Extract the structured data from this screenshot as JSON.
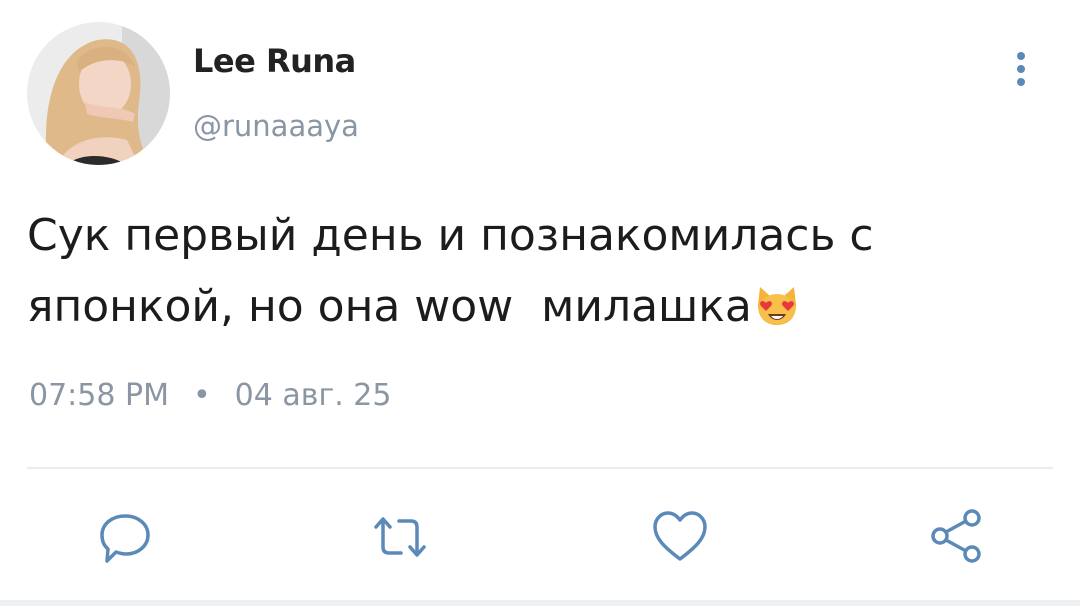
{
  "tweet": {
    "author": {
      "display_name": "Lee Runa",
      "handle": "@runaaaya"
    },
    "text_lines": [
      "Сук первый день и познакомилась с",
      "японкой, но она wow  милашка"
    ],
    "emoji": "smiling-cat-heart-eyes-emoji",
    "time": "07:58 PM",
    "separator": "•",
    "date": "04 авг. 25"
  },
  "actions": {
    "icons": [
      "reply-icon",
      "retweet-icon",
      "like-icon",
      "share-icon"
    ]
  },
  "colors": {
    "text": "#1c1c1c",
    "muted": "#8a96a3",
    "icon": "#5c8ab8",
    "divider": "#e9edf0"
  }
}
